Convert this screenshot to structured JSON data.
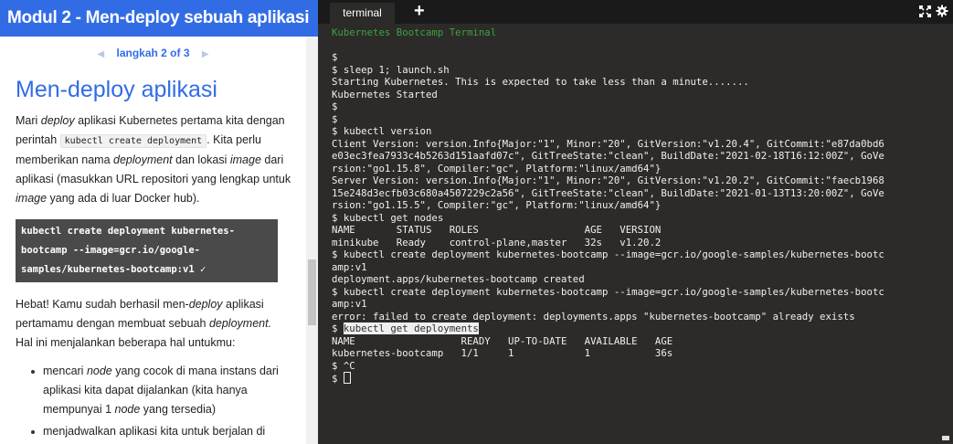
{
  "left_panel": {
    "header_title": "Modul 2 - Men-deploy sebuah aplikasi",
    "step_label": "langkah 2 of 3",
    "page_title": "Men-deploy aplikasi",
    "p1": {
      "t1": "Mari ",
      "em1": "deploy",
      "t2": " aplikasi Kubernetes pertama kita dengan perintah ",
      "code": "kubectl create deployment",
      "t3": ". Kita perlu memberikan nama ",
      "em2": "deployment",
      "t4": " dan lokasi ",
      "em3": "image",
      "t5": " dari aplikasi (masukkan URL repositori yang lengkap untuk ",
      "em4": "image",
      "t6": " yang ada di luar Docker hub)."
    },
    "code_block": "kubectl create deployment kubernetes-bootcamp --image=gcr.io/google-samples/kubernetes-bootcamp:v1 ✓",
    "p2": {
      "t1": "Hebat! Kamu sudah berhasil men-",
      "em1": "deploy",
      "t2": " aplikasi pertamamu dengan membuat sebuah ",
      "em2": "deployment.",
      "t3": " Hal ini menjalankan beberapa hal untukmu:"
    },
    "bullets": [
      {
        "t1": "mencari ",
        "em": "node",
        "t2": " yang cocok di mana instans dari aplikasi kita dapat dijalankan (kita hanya mempunyai 1 ",
        "em2": "node",
        "t3": " yang tersedia)"
      },
      {
        "t1": "menjadwalkan aplikasi kita untuk berjalan di Node tersebut"
      }
    ]
  },
  "terminal": {
    "tab_label": "terminal",
    "add_tab_label": "+",
    "icons": {
      "fullscreen": "fullscreen-icon",
      "settings": "gear-icon"
    },
    "colors": {
      "background": "#2c2b29",
      "text": "#f0f0f0",
      "banner": "#3fa13f"
    },
    "lines": [
      "Kubernetes Bootcamp Terminal",
      "",
      "$",
      "$ sleep 1; launch.sh",
      "Starting Kubernetes. This is expected to take less than a minute.......",
      "Kubernetes Started",
      "$",
      "$",
      "$ kubectl version",
      "Client Version: version.Info{Major:\"1\", Minor:\"20\", GitVersion:\"v1.20.4\", GitCommit:\"e87da0bd6",
      "e03ec3fea7933c4b5263d151aafd07c\", GitTreeState:\"clean\", BuildDate:\"2021-02-18T16:12:00Z\", GoVe",
      "rsion:\"go1.15.8\", Compiler:\"gc\", Platform:\"linux/amd64\"}",
      "Server Version: version.Info{Major:\"1\", Minor:\"20\", GitVersion:\"v1.20.2\", GitCommit:\"faecb1968",
      "15e248d3ecfb03c680a4507229c2a56\", GitTreeState:\"clean\", BuildDate:\"2021-01-13T13:20:00Z\", GoVe",
      "rsion:\"go1.15.5\", Compiler:\"gc\", Platform:\"linux/amd64\"}",
      "$ kubectl get nodes",
      "NAME       STATUS   ROLES                  AGE   VERSION",
      "minikube   Ready    control-plane,master   32s   v1.20.2",
      "$ kubectl create deployment kubernetes-bootcamp --image=gcr.io/google-samples/kubernetes-bootc",
      "amp:v1",
      "deployment.apps/kubernetes-bootcamp created",
      "$ kubectl create deployment kubernetes-bootcamp --image=gcr.io/google-samples/kubernetes-bootc",
      "amp:v1",
      "error: failed to create deployment: deployments.apps \"kubernetes-bootcamp\" already exists",
      "kubectl get deployments",
      "NAME                  READY   UP-TO-DATE   AVAILABLE   AGE",
      "kubernetes-bootcamp   1/1     1            1           36s",
      "$ ^C",
      "$"
    ]
  }
}
